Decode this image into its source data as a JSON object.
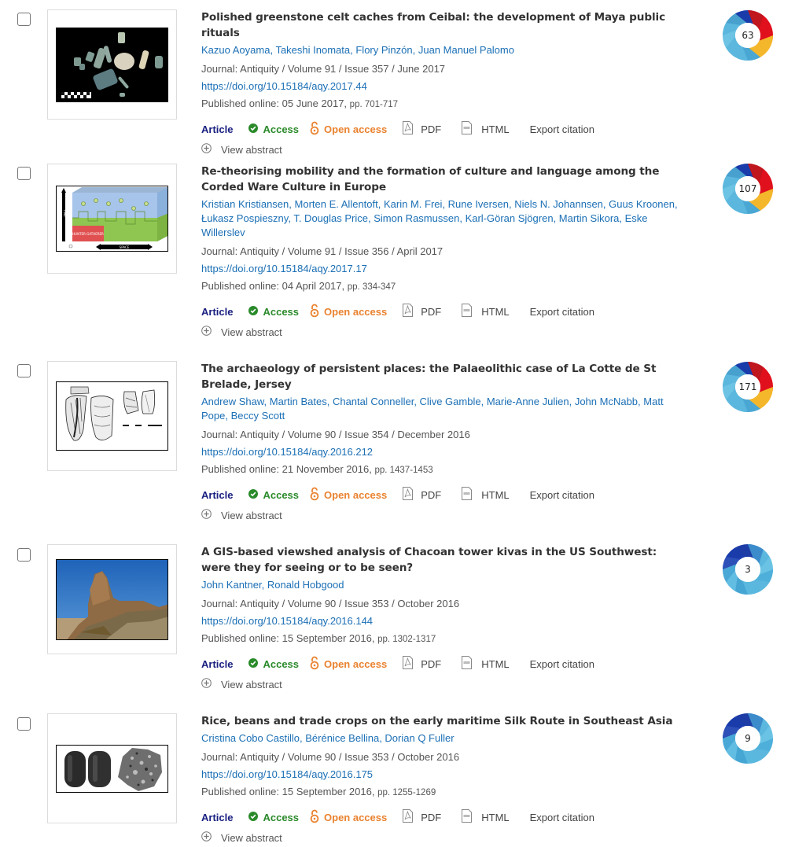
{
  "colors": {
    "title": "#333333",
    "link": "#1b6fb5",
    "article_type": "#1a2080",
    "access": "#2a8a2a",
    "open_access": "#e9822f",
    "altmetric_blue_dark": "#1a3caa",
    "altmetric_blue_light": "#5bb7dd",
    "altmetric_red": "#e0101c",
    "altmetric_yellow": "#f4b72b"
  },
  "labels": {
    "article_type": "Article",
    "access": "Access",
    "open_access": "Open access",
    "pdf": "PDF",
    "html": "HTML",
    "export_citation": "Export citation",
    "view_abstract": "View abstract"
  },
  "results": [
    {
      "title": "Polished greenstone celt caches from Ceibal: the development of Maya public rituals",
      "authors": [
        "Kazuo Aoyama",
        "Takeshi Inomata",
        "Flory Pinzón",
        "Juan Manuel Palomo"
      ],
      "journal_line": "Journal: Antiquity / Volume 91 / Issue 357 / June 2017",
      "doi": "https://doi.org/10.15184/aqy.2017.44",
      "published": "Published online: 05 June 2017,",
      "pages": "pp. 701-717",
      "altmetric": "63",
      "thumbnail": "greenstone-celts-photo"
    },
    {
      "title": "Re-theorising mobility and the formation of culture and language among the Corded Ware Culture in Europe",
      "authors": [
        "Kristian Kristiansen",
        "Morten E. Allentoft",
        "Karin M. Frei",
        "Rune Iversen",
        "Niels N. Johannsen",
        "Guus Kroonen",
        "Łukasz Pospieszny",
        "T. Douglas Price",
        "Simon Rasmussen",
        "Karl-Göran Sjögren",
        "Martin Sikora",
        "Eske Willerslev"
      ],
      "journal_line": "Journal: Antiquity / Volume 91 / Issue 356 / April 2017",
      "doi": "https://doi.org/10.15184/aqy.2017.17",
      "published": "Published online: 04 April 2017,",
      "pages": "pp. 334-347",
      "altmetric": "107",
      "thumbnail": "time-space-diagram",
      "diagram_text": {
        "time": "TIME",
        "space": "SPACE",
        "hunter_gatherer": "HUNTER-GATHERER"
      }
    },
    {
      "title": "The archaeology of persistent places: the Palaeolithic case of La Cotte de St Brelade, Jersey",
      "authors": [
        "Andrew Shaw",
        "Martin Bates",
        "Chantal Conneller",
        "Clive Gamble",
        "Marie-Anne Julien",
        "John McNabb",
        "Matt Pope",
        "Beccy Scott"
      ],
      "journal_line": "Journal: Antiquity / Volume 90 / Issue 354 / December 2016",
      "doi": "https://doi.org/10.15184/aqy.2016.212",
      "published": "Published online: 21 November 2016,",
      "pages": "pp. 1437-1453",
      "altmetric": "171",
      "thumbnail": "stone-tool-drawings"
    },
    {
      "title": "A GIS-based viewshed analysis of Chacoan tower kivas in the US Southwest: were they for seeing or to be seen?",
      "authors": [
        "John Kantner",
        "Ronald Hobgood"
      ],
      "journal_line": "Journal: Antiquity / Volume 90 / Issue 353 / October 2016",
      "doi": "https://doi.org/10.15184/aqy.2016.144",
      "published": "Published online: 15 September 2016,",
      "pages": "pp. 1302-1317",
      "altmetric": "3",
      "thumbnail": "tower-kiva-photo"
    },
    {
      "title": "Rice, beans and trade crops on the early maritime Silk Route in Southeast Asia",
      "authors": [
        "Cristina Cobo Castillo",
        "Bérénice Bellina",
        "Dorian Q Fuller"
      ],
      "journal_line": "Journal: Antiquity / Volume 90 / Issue 353 / October 2016",
      "doi": "https://doi.org/10.15184/aqy.2016.175",
      "published": "Published online: 15 September 2016,",
      "pages": "pp. 1255-1269",
      "altmetric": "9",
      "thumbnail": "charred-grains-photo"
    }
  ]
}
